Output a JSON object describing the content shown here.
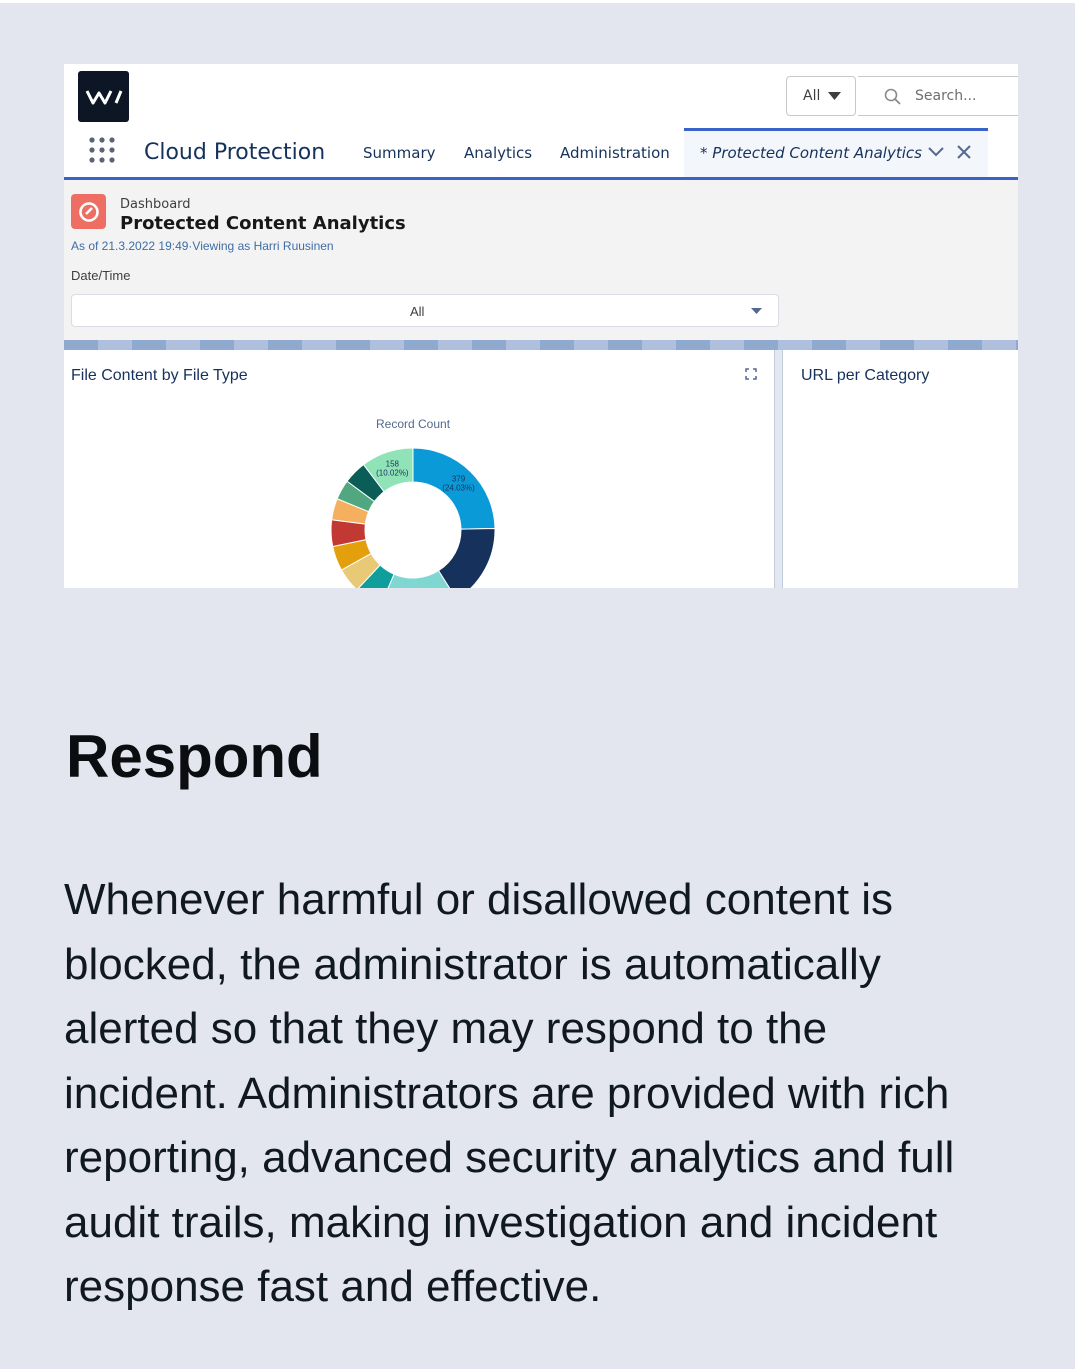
{
  "header": {
    "search_scope": "All",
    "search_placeholder": "Search..."
  },
  "nav": {
    "app_name": "Cloud Protection",
    "items": [
      "Summary",
      "Analytics",
      "Administration"
    ],
    "active_tab": "* Protected Content Analytics"
  },
  "dashboard": {
    "kicker": "Dashboard",
    "title": "Protected Content Analytics",
    "as_of": "As of 21.3.2022 19:49·Viewing as Harri Ruusinen",
    "filter_label": "Date/Time",
    "filter_value": "All"
  },
  "panels": {
    "left_title": "File Content by File Type",
    "right_title": "URL per Category"
  },
  "chart_data": {
    "type": "pie",
    "title": "Record Count",
    "slices": [
      {
        "label": "379 (24.03%)",
        "value": 379,
        "color": "#0b9ad8"
      },
      {
        "label": "",
        "value": 251,
        "color": "#16325c"
      },
      {
        "label": "236",
        "value": 236,
        "color": "#80d7d1"
      },
      {
        "label": "",
        "value": 85,
        "color": "#0f9e9c"
      },
      {
        "label": "",
        "value": 75,
        "color": "#e8c975"
      },
      {
        "label": "",
        "value": 75,
        "color": "#e4a00c"
      },
      {
        "label": "",
        "value": 80,
        "color": "#c23934"
      },
      {
        "label": "",
        "value": 65,
        "color": "#f4b05e"
      },
      {
        "label": "",
        "value": 60,
        "color": "#51a880"
      },
      {
        "label": "",
        "value": 70,
        "color": "#0b5e57"
      },
      {
        "label": "158 (10.02%)",
        "value": 158,
        "color": "#8fe3b6"
      }
    ]
  },
  "content": {
    "heading": "Respond",
    "paragraph": "Whenever harmful or disallowed content is blocked, the administrator is automatically alerted so that they may respond to the incident. Administrators are provided with rich reporting, advanced security analytics and full audit trails, making investigation and incident response fast and effective."
  }
}
